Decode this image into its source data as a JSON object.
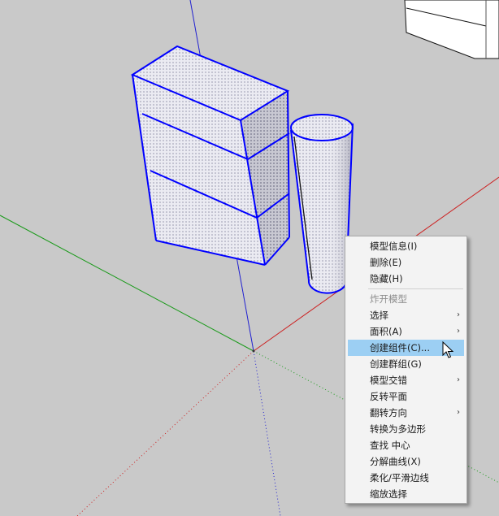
{
  "menu": {
    "items": [
      {
        "label": "模型信息(I)",
        "enabled": true,
        "submenu": false
      },
      {
        "label": "删除(E)",
        "enabled": true,
        "submenu": false
      },
      {
        "label": "隐藏(H)",
        "enabled": true,
        "submenu": false
      },
      {
        "label": "炸开模型",
        "enabled": false,
        "submenu": false
      },
      {
        "label": "选择",
        "enabled": true,
        "submenu": true
      },
      {
        "label": "面积(A)",
        "enabled": true,
        "submenu": true
      },
      {
        "label": "创建组件(C)...",
        "enabled": true,
        "submenu": false,
        "highlighted": true
      },
      {
        "label": "创建群组(G)",
        "enabled": true,
        "submenu": false
      },
      {
        "label": "模型交错",
        "enabled": true,
        "submenu": true
      },
      {
        "label": "反转平面",
        "enabled": true,
        "submenu": false
      },
      {
        "label": "翻转方向",
        "enabled": true,
        "submenu": true
      },
      {
        "label": "转换为多边形",
        "enabled": true,
        "submenu": false
      },
      {
        "label": "查找 中心",
        "enabled": true,
        "submenu": false
      },
      {
        "label": "分解曲线(X)",
        "enabled": true,
        "submenu": false
      },
      {
        "label": "柔化/平滑边线",
        "enabled": true,
        "submenu": false
      },
      {
        "label": "缩放选择",
        "enabled": true,
        "submenu": false
      }
    ],
    "submenu_glyph": "›"
  },
  "colors": {
    "background": "#c9c9c9",
    "selection_edge": "#0000ff",
    "axis_red": "#cc0000",
    "axis_green": "#009900",
    "axis_blue": "#0000cc",
    "menu_highlight": "#9ccff3"
  }
}
